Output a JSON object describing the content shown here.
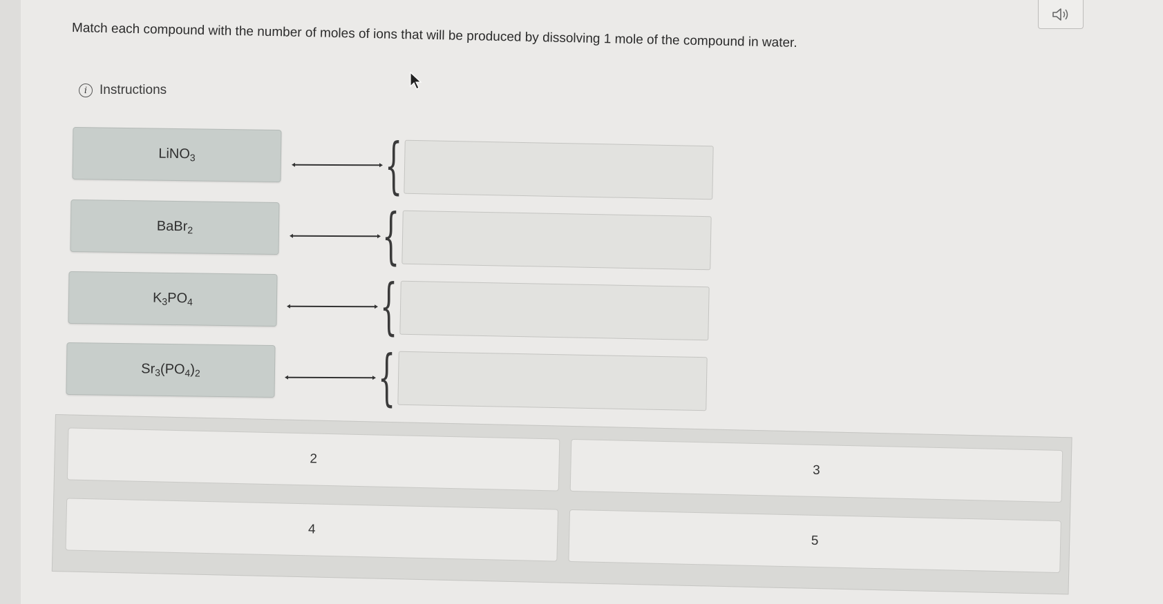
{
  "question": {
    "text": "Match each compound with the number of moles of ions that will be produced by dissolving 1 mole of the compound in water."
  },
  "audio": {
    "icon": "speaker-icon"
  },
  "instructions": {
    "label": "Instructions",
    "icon": "info-icon",
    "icon_glyph": "i"
  },
  "compounds": [
    {
      "parts": [
        {
          "t": "LiNO"
        },
        {
          "s": "3"
        }
      ]
    },
    {
      "parts": [
        {
          "t": "BaBr"
        },
        {
          "s": "2"
        }
      ]
    },
    {
      "parts": [
        {
          "t": "K"
        },
        {
          "s": "3"
        },
        {
          "t": "PO"
        },
        {
          "s": "4"
        }
      ]
    },
    {
      "parts": [
        {
          "t": "Sr"
        },
        {
          "s": "3"
        },
        {
          "t": "(PO"
        },
        {
          "s": "4"
        },
        {
          "t": ")"
        },
        {
          "s": "2"
        }
      ]
    }
  ],
  "answers": [
    {
      "label": "2"
    },
    {
      "label": "3"
    },
    {
      "label": "4"
    },
    {
      "label": "5"
    }
  ],
  "colors": {
    "compound_bg": "#c8cecb",
    "drop_bg": "#e2e2df",
    "bank_bg": "#d9d9d6",
    "choice_bg": "#ecebe9"
  }
}
